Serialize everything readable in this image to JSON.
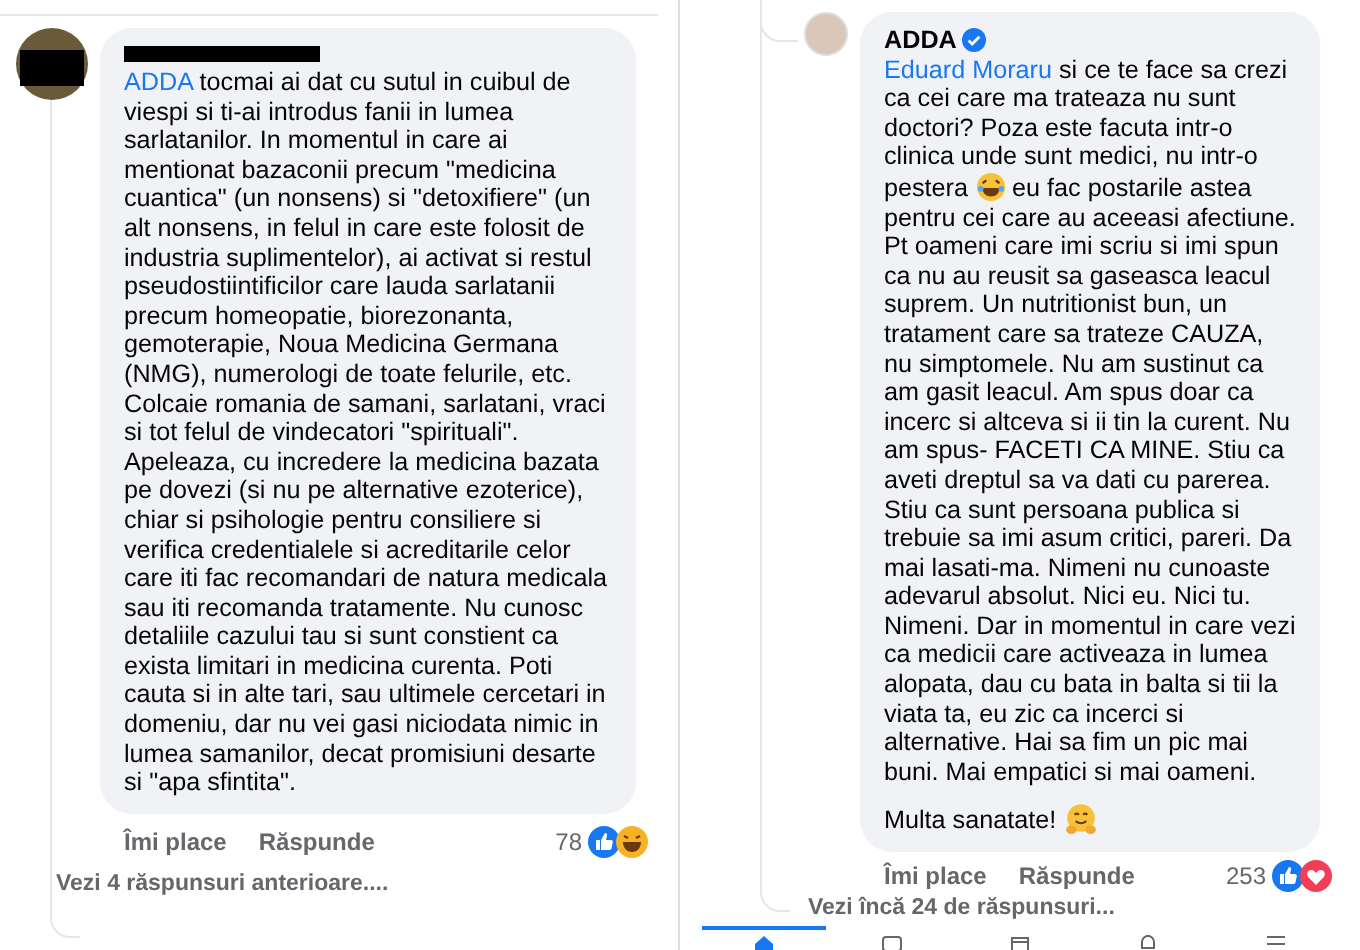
{
  "comments": [
    {
      "paragraphs": [
        [
          {
            "kind": "mention",
            "text": "ADDA"
          },
          {
            "kind": "text",
            "text": "tocmai ai dat cu sutul in cuibul de viespi si ti-ai introdus fanii in lumea sarlatanilor. In momentul in care ai mentionat bazaconii precum \"medicina cuantica\" (un nonsens) si \"detoxifiere\" (un alt nonsens, in felul in care este folosit de industria suplimentelor), ai activat si restul pseudostiintificilor care lauda sarlatanii precum homeopatie, biorezonanta, gemoterapie, Noua Medicina Germana (NMG), numerologi de toate felurile, etc. Colcaie romania de samani, sarlatani, vraci si tot felul de vindecatori \"spirituali\". Apeleaza, cu incredere la medicina bazata pe dovezi (si nu pe alternative ezoterice), chiar si psihologie pentru consiliere si verifica credentialele si acreditarile celor care iti fac recomandari de natura medicala sau iti recomanda tratamente. Nu cunosc detaliile cazului tau si sunt constient ca exista limitari in medicina curenta. Poti cauta si in alte tari, sau ultimele cercetari in domeniu, dar nu vei gasi niciodata nimic in lumea samanilor, decat promisiuni desarte si \"apa sfintita\"."
          }
        ]
      ],
      "like": "Îmi place",
      "reply": "Răspunde",
      "count": "78",
      "reactions": [
        {
          "kind": "like"
        },
        {
          "kind": "haha"
        }
      ],
      "more_replies": "Vezi 4 răspunsuri anterioare...."
    },
    {
      "author": "ADDA",
      "verified": true,
      "paragraphs": [
        [
          {
            "kind": "mention",
            "text": "Eduard Moraru"
          },
          {
            "kind": "text",
            "text": "si ce te face sa crezi ca cei care ma trateaza nu sunt doctori? Poza este facuta intr-o clinica unde sunt medici, nu intr-o pestera"
          },
          {
            "kind": "laughing_emoji"
          },
          {
            "kind": "text",
            "text": "eu fac postarile astea pentru cei care au aceeasi afectiune. Pt oameni care imi scriu si imi spun ca nu au reusit sa gaseasca leacul suprem. Un nutritionist bun, un tratament care sa trateze CAUZA, nu simptomele. Nu am sustinut ca am gasit leacul. Am spus doar ca incerc si altceva si ii tin la curent. Nu am spus- FACETI CA MINE. Stiu ca aveti dreptul sa va dati cu parerea. Stiu ca sunt persoana publica si trebuie sa imi asum critici, pareri. Da mai lasati-ma. Nimeni nu cunoaste adevarul absolut. Nici eu. Nici tu. Nimeni. Dar in momentul in care vezi ca medicii care activeaza in lumea alopata, dau cu bata in balta si tii la viata ta, eu zic ca incerci si alternative. Hai sa fim un pic mai buni. Mai empatici si mai oameni."
          }
        ],
        [
          {
            "kind": "text",
            "text": "Multa sanatate!"
          },
          {
            "kind": "hugging_emoji"
          }
        ]
      ],
      "like": "Îmi place",
      "reply": "Răspunde",
      "count": "253",
      "reactions": [
        {
          "kind": "like"
        },
        {
          "kind": "love"
        }
      ],
      "more_replies": "Vezi încă 24 de răspunsuri..."
    }
  ],
  "nav_tabs": [
    {
      "kind": "home",
      "selected": true
    },
    {
      "kind": "video",
      "selected": false
    },
    {
      "kind": "store",
      "selected": false
    },
    {
      "kind": "bell",
      "selected": false
    },
    {
      "kind": "menu",
      "selected": false
    }
  ]
}
